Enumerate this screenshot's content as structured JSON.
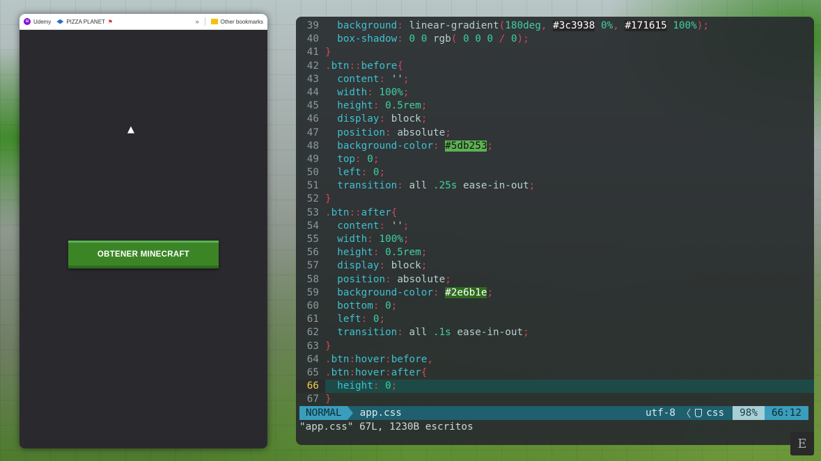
{
  "browser": {
    "bookmarks": [
      {
        "label": "Udemy",
        "icon": "udemy-icon"
      },
      {
        "label": "PIZZA PLANET",
        "icon": "pizza-planet-icon"
      }
    ],
    "more_label": "»",
    "other_bookmarks": "Other bookmarks",
    "page": {
      "button_label": "OBTENER MINECRAFT"
    }
  },
  "editor": {
    "lines": [
      {
        "n": "39",
        "tokens": [
          [
            "i",
            "  "
          ],
          [
            "prop",
            "background"
          ],
          [
            "punc",
            ": "
          ],
          [
            "val",
            "linear-gradient"
          ],
          [
            "punc",
            "("
          ],
          [
            "num",
            "180deg"
          ],
          [
            "punc",
            ", "
          ],
          [
            "hexd",
            "#3c3938"
          ],
          [
            "i",
            " "
          ],
          [
            "pct",
            "0%"
          ],
          [
            "punc",
            ", "
          ],
          [
            "hexd",
            "#171615"
          ],
          [
            "i",
            " "
          ],
          [
            "pct",
            "100%"
          ],
          [
            "punc",
            ");"
          ]
        ]
      },
      {
        "n": "40",
        "tokens": [
          [
            "i",
            "  "
          ],
          [
            "prop",
            "box-shadow"
          ],
          [
            "punc",
            ": "
          ],
          [
            "num",
            "0 0 "
          ],
          [
            "val",
            "rgb"
          ],
          [
            "punc",
            "( "
          ],
          [
            "num",
            "0 0 0 "
          ],
          [
            "punc",
            "/ "
          ],
          [
            "num",
            "0"
          ],
          [
            "punc",
            ");"
          ]
        ]
      },
      {
        "n": "41",
        "tokens": [
          [
            "punc",
            "}"
          ]
        ]
      },
      {
        "n": "42",
        "tokens": [
          [
            "punc",
            "."
          ],
          [
            "sel",
            "btn"
          ],
          [
            "punc",
            "::"
          ],
          [
            "sel",
            "before"
          ],
          [
            "punc",
            "{"
          ]
        ]
      },
      {
        "n": "43",
        "tokens": [
          [
            "i",
            "  "
          ],
          [
            "prop",
            "content"
          ],
          [
            "punc",
            ": "
          ],
          [
            "val",
            "''"
          ],
          [
            "punc",
            ";"
          ]
        ]
      },
      {
        "n": "44",
        "tokens": [
          [
            "i",
            "  "
          ],
          [
            "prop",
            "width"
          ],
          [
            "punc",
            ": "
          ],
          [
            "num",
            "100%"
          ],
          [
            "punc",
            ";"
          ]
        ]
      },
      {
        "n": "45",
        "tokens": [
          [
            "i",
            "  "
          ],
          [
            "prop",
            "height"
          ],
          [
            "punc",
            ": "
          ],
          [
            "num",
            "0.5rem"
          ],
          [
            "punc",
            ";"
          ]
        ]
      },
      {
        "n": "46",
        "tokens": [
          [
            "i",
            "  "
          ],
          [
            "prop",
            "display"
          ],
          [
            "punc",
            ": "
          ],
          [
            "val",
            "block"
          ],
          [
            "punc",
            ";"
          ]
        ]
      },
      {
        "n": "47",
        "tokens": [
          [
            "i",
            "  "
          ],
          [
            "prop",
            "position"
          ],
          [
            "punc",
            ": "
          ],
          [
            "val",
            "absolute"
          ],
          [
            "punc",
            ";"
          ]
        ]
      },
      {
        "n": "48",
        "tokens": [
          [
            "i",
            "  "
          ],
          [
            "prop",
            "background-color"
          ],
          [
            "punc",
            ": "
          ],
          [
            "hexg1",
            "#5db253"
          ],
          [
            "punc",
            ";"
          ]
        ]
      },
      {
        "n": "49",
        "tokens": [
          [
            "i",
            "  "
          ],
          [
            "prop",
            "top"
          ],
          [
            "punc",
            ": "
          ],
          [
            "num",
            "0"
          ],
          [
            "punc",
            ";"
          ]
        ]
      },
      {
        "n": "50",
        "tokens": [
          [
            "i",
            "  "
          ],
          [
            "prop",
            "left"
          ],
          [
            "punc",
            ": "
          ],
          [
            "num",
            "0"
          ],
          [
            "punc",
            ";"
          ]
        ]
      },
      {
        "n": "51",
        "tokens": [
          [
            "i",
            "  "
          ],
          [
            "prop",
            "transition"
          ],
          [
            "punc",
            ": "
          ],
          [
            "val",
            "all "
          ],
          [
            "num",
            ".25s "
          ],
          [
            "val",
            "ease-in-out"
          ],
          [
            "punc",
            ";"
          ]
        ]
      },
      {
        "n": "52",
        "tokens": [
          [
            "punc",
            "}"
          ]
        ]
      },
      {
        "n": "53",
        "tokens": [
          [
            "punc",
            "."
          ],
          [
            "sel",
            "btn"
          ],
          [
            "punc",
            "::"
          ],
          [
            "sel",
            "after"
          ],
          [
            "punc",
            "{"
          ]
        ]
      },
      {
        "n": "54",
        "tokens": [
          [
            "i",
            "  "
          ],
          [
            "prop",
            "content"
          ],
          [
            "punc",
            ": "
          ],
          [
            "val",
            "''"
          ],
          [
            "punc",
            ";"
          ]
        ]
      },
      {
        "n": "55",
        "tokens": [
          [
            "i",
            "  "
          ],
          [
            "prop",
            "width"
          ],
          [
            "punc",
            ": "
          ],
          [
            "num",
            "100%"
          ],
          [
            "punc",
            ";"
          ]
        ]
      },
      {
        "n": "56",
        "tokens": [
          [
            "i",
            "  "
          ],
          [
            "prop",
            "height"
          ],
          [
            "punc",
            ": "
          ],
          [
            "num",
            "0.5rem"
          ],
          [
            "punc",
            ";"
          ]
        ]
      },
      {
        "n": "57",
        "tokens": [
          [
            "i",
            "  "
          ],
          [
            "prop",
            "display"
          ],
          [
            "punc",
            ": "
          ],
          [
            "val",
            "block"
          ],
          [
            "punc",
            ";"
          ]
        ]
      },
      {
        "n": "58",
        "tokens": [
          [
            "i",
            "  "
          ],
          [
            "prop",
            "position"
          ],
          [
            "punc",
            ": "
          ],
          [
            "val",
            "absolute"
          ],
          [
            "punc",
            ";"
          ]
        ]
      },
      {
        "n": "59",
        "tokens": [
          [
            "i",
            "  "
          ],
          [
            "prop",
            "background-color"
          ],
          [
            "punc",
            ": "
          ],
          [
            "hexg2",
            "#2e6b1e"
          ],
          [
            "punc",
            ";"
          ]
        ]
      },
      {
        "n": "60",
        "tokens": [
          [
            "i",
            "  "
          ],
          [
            "prop",
            "bottom"
          ],
          [
            "punc",
            ": "
          ],
          [
            "num",
            "0"
          ],
          [
            "punc",
            ";"
          ]
        ]
      },
      {
        "n": "61",
        "tokens": [
          [
            "i",
            "  "
          ],
          [
            "prop",
            "left"
          ],
          [
            "punc",
            ": "
          ],
          [
            "num",
            "0"
          ],
          [
            "punc",
            ";"
          ]
        ]
      },
      {
        "n": "62",
        "tokens": [
          [
            "i",
            "  "
          ],
          [
            "prop",
            "transition"
          ],
          [
            "punc",
            ": "
          ],
          [
            "val",
            "all "
          ],
          [
            "num",
            ".1s "
          ],
          [
            "val",
            "ease-in-out"
          ],
          [
            "punc",
            ";"
          ]
        ]
      },
      {
        "n": "63",
        "tokens": [
          [
            "punc",
            "}"
          ]
        ]
      },
      {
        "n": "64",
        "tokens": [
          [
            "punc",
            "."
          ],
          [
            "sel",
            "btn"
          ],
          [
            "punc",
            ":"
          ],
          [
            "sel",
            "hover"
          ],
          [
            "punc",
            ":"
          ],
          [
            "sel",
            "before"
          ],
          [
            "punc",
            ","
          ]
        ]
      },
      {
        "n": "65",
        "tokens": [
          [
            "punc",
            "."
          ],
          [
            "sel",
            "btn"
          ],
          [
            "punc",
            ":"
          ],
          [
            "sel",
            "hover"
          ],
          [
            "punc",
            ":"
          ],
          [
            "sel",
            "after"
          ],
          [
            "punc",
            "{"
          ]
        ]
      },
      {
        "n": "66",
        "current": true,
        "tokens": [
          [
            "i",
            "  "
          ],
          [
            "prop",
            "height"
          ],
          [
            "punc",
            ": "
          ],
          [
            "num",
            "0"
          ],
          [
            "punc",
            ";"
          ]
        ]
      },
      {
        "n": "67",
        "tokens": [
          [
            "punc",
            "}"
          ]
        ]
      }
    ],
    "status": {
      "mode": "NORMAL",
      "filename": "app.css",
      "encoding": "utf-8",
      "separator": "〈",
      "filetype": "css",
      "percent": "98%",
      "position": "66:12"
    },
    "message": "\"app.css\" 67L, 1230B escritos"
  },
  "colors": {
    "button_green": "#3c8527",
    "button_top": "#5db253",
    "button_bottom": "#2e6b1e",
    "status_accent": "#3a9dbc"
  }
}
